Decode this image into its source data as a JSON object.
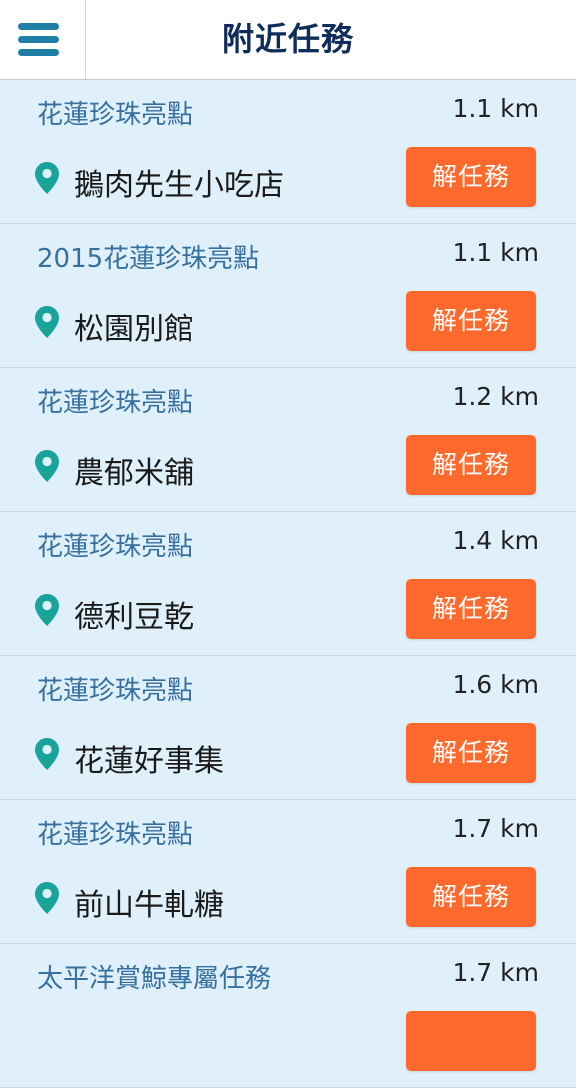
{
  "header": {
    "title": "附近任務",
    "menu_icon": "hamburger-menu-icon"
  },
  "colors": {
    "background": "#dff0fb",
    "header_bg": "#ffffff",
    "menu_icon": "#1f7fa6",
    "title": "#0f2d5a",
    "category_text": "#36709f",
    "pin": "#1aa39a",
    "action_button": "#ff6a2c"
  },
  "tasks": [
    {
      "category": "花蓮珍珠亮點",
      "distance": "1.1 km",
      "place": "鵝肉先生小吃店",
      "action_label": "解任務",
      "icon": "map-pin-icon"
    },
    {
      "category": "2015花蓮珍珠亮點",
      "distance": "1.1 km",
      "place": "松園別館",
      "action_label": "解任務",
      "icon": "map-pin-icon"
    },
    {
      "category": "花蓮珍珠亮點",
      "distance": "1.2 km",
      "place": "農郁米舖",
      "action_label": "解任務",
      "icon": "map-pin-icon"
    },
    {
      "category": "花蓮珍珠亮點",
      "distance": "1.4 km",
      "place": "德利豆乾",
      "action_label": "解任務",
      "icon": "map-pin-icon"
    },
    {
      "category": "花蓮珍珠亮點",
      "distance": "1.6 km",
      "place": "花蓮好事集",
      "action_label": "解任務",
      "icon": "map-pin-icon"
    },
    {
      "category": "花蓮珍珠亮點",
      "distance": "1.7 km",
      "place": "前山牛軋糖",
      "action_label": "解任務",
      "icon": "map-pin-icon"
    },
    {
      "category": "太平洋賞鯨專屬任務",
      "distance": "1.7 km",
      "place": "",
      "action_label": "",
      "icon": "map-pin-icon"
    }
  ]
}
